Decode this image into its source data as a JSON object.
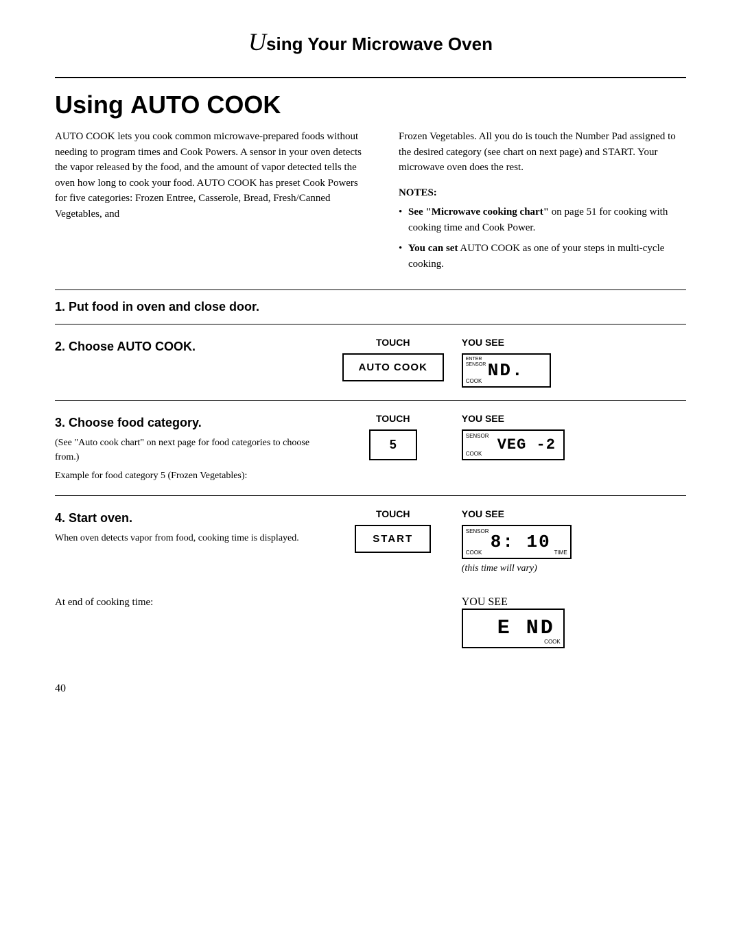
{
  "header": {
    "cursive": "U",
    "rest": "sing Your Microwave Oven"
  },
  "section_title": {
    "prefix": "Using ",
    "bold": "AUTO COOK"
  },
  "intro": {
    "left": "AUTO COOK lets you cook common microwave-prepared foods without needing to program times and Cook Powers. A sensor in your oven detects the vapor released by the food, and the amount of vapor detected tells the oven how long to cook your food. AUTO COOK has preset Cook Powers for five categories: Frozen Entree, Casserole, Bread, Fresh/Canned Vegetables, and",
    "right": "Frozen Vegetables. All you do is touch the Number Pad assigned to the desired category (see chart on next page) and START. Your microwave oven does the rest.",
    "notes_title": "NOTES:",
    "notes": [
      "See \"Microwave cooking chart\" on page 51 for cooking with cooking time and Cook Power.",
      "You can set AUTO COOK as one of your steps in multi-cycle cooking."
    ]
  },
  "step1": {
    "number": "1.",
    "heading": "Put food in oven and close door."
  },
  "step2": {
    "number": "2.",
    "heading": "Choose AUTO COOK.",
    "touch_label": "TOUCH",
    "button_label": "AUTO COOK",
    "yousee_label": "YOU SEE",
    "display_enter": "ENTER\nSENSOR",
    "display_cook": "COOK",
    "display_text": "ND."
  },
  "step3": {
    "number": "3.",
    "heading": "Choose food category.",
    "subtext1": "(See \"Auto cook chart\" on next page for food categories to choose from.)",
    "subtext2": "Example for food category 5 (Frozen Vegetables):",
    "touch_label": "TOUCH",
    "button_label": "5",
    "yousee_label": "YOU SEE",
    "display_sensor": "SENSOR",
    "display_cook": "COOK",
    "display_text": "VEG -2"
  },
  "step4": {
    "number": "4.",
    "heading": "Start oven.",
    "subtext": "When oven detects vapor from food, cooking time is displayed.",
    "touch_label": "TOUCH",
    "button_label": "START",
    "yousee_label": "YOU SEE",
    "display_sensor": "SENSOR",
    "display_cook": "COOK",
    "display_time": "TIME",
    "display_text": "8: 10",
    "this_time_vary": "(this time will vary)",
    "at_end_label": "At end of cooking time:",
    "end_yousee_label": "YOU SEE",
    "end_display_text": "E ND"
  },
  "page_number": "40"
}
